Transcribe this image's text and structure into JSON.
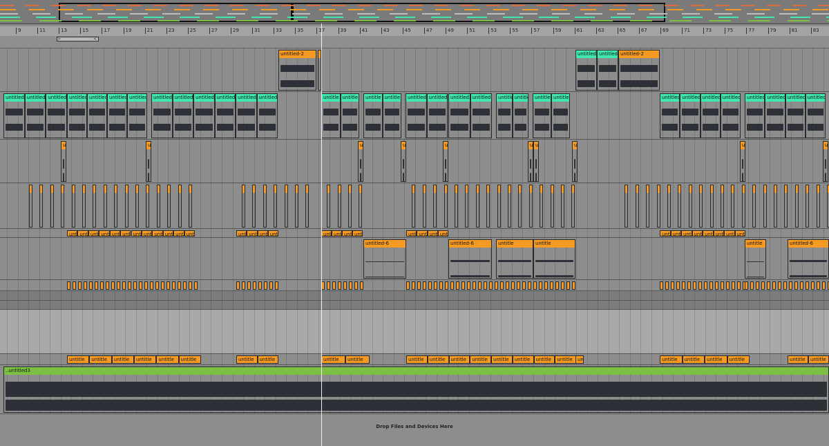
{
  "ruler": {
    "bars": [
      "9",
      "11",
      "13",
      "15",
      "17",
      "19",
      "21",
      "23",
      "25",
      "27",
      "29",
      "31",
      "33",
      "35",
      "37",
      "39",
      "41",
      "43",
      "45",
      "47",
      "49",
      "51",
      "53",
      "55",
      "57",
      "59",
      "61",
      "63",
      "65",
      "67",
      "69",
      "71",
      "73",
      "75",
      "77",
      "79",
      "81",
      "83",
      "85"
    ],
    "loop_brace_start": ">",
    "loop_brace_end": "<"
  },
  "clip_labels": {
    "u2": "untitled-2",
    "u6": "untitled-6",
    "u3": "untitled3",
    "u3_prefix": "..untitled3",
    "short2": "untitled2",
    "untit": "untitle",
    "unti": "unti",
    "un": "un",
    "u": "u",
    "t": "untitled2"
  },
  "drop_zone": {
    "text": "Drop Files and Devices Here"
  },
  "colors": {
    "orange": "#f59a22",
    "teal": "#3ee8b0",
    "green": "#7bc043",
    "waveform": "#2e3037",
    "playhead": "#f2f2f2"
  }
}
